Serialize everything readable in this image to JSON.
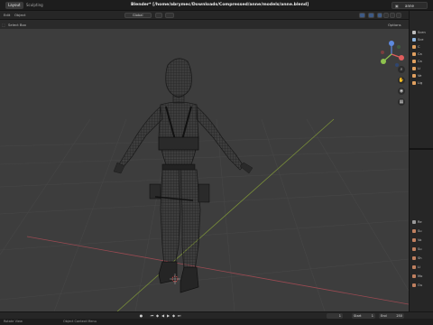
{
  "window": {
    "title": "Blender* [/home/abrymec/Downloads/Compressed/anne/models/anne.blend]"
  },
  "workspace_tabs": [
    {
      "label": "Layout",
      "active": true
    },
    {
      "label": "Sculpting",
      "active": false
    }
  ],
  "scene": {
    "name": "anne"
  },
  "header": {
    "menus": [
      "Edit",
      "Object"
    ],
    "transform_orientation": "Global",
    "select_mode": "Select Box",
    "options_label": "Options"
  },
  "outliner": {
    "items": [
      {
        "label": "Scen",
        "color": "#bdbdbd"
      },
      {
        "label": "Sce",
        "color": "#8fb6e0"
      },
      {
        "label": "C",
        "color": "#e0a060"
      },
      {
        "label": "Ca",
        "color": "#e0a060"
      },
      {
        "label": "Ca",
        "color": "#e0a060"
      },
      {
        "label": "Li",
        "color": "#e0a060"
      },
      {
        "label": "Ve",
        "color": "#e0a060"
      },
      {
        "label": "Lig",
        "color": "#e0a060"
      }
    ]
  },
  "properties": {
    "items": [
      {
        "label": "Re",
        "color": "#9a9a9a"
      },
      {
        "label": "Su",
        "color": "#c08060"
      },
      {
        "label": "Vo",
        "color": "#c08060"
      },
      {
        "label": "Su",
        "color": "#c08060"
      },
      {
        "label": "Sh",
        "color": "#c08060"
      },
      {
        "label": "Li",
        "color": "#c08060"
      },
      {
        "label": "Mo",
        "color": "#c08060"
      },
      {
        "label": "Ou",
        "color": "#c08060"
      }
    ]
  },
  "timeline": {
    "current_frame": "1",
    "start_label": "Start",
    "start_value": "1",
    "end_label": "End",
    "end_value": "250"
  },
  "status": {
    "left": "Rotate View",
    "middle": "Object Context Menu"
  },
  "colors": {
    "viewport_bg": "#3d3d3d",
    "grid": "#484848",
    "axis_x": "#9a4a52",
    "axis_y": "#7a8f3a",
    "wire": "#1a1a1a"
  },
  "icons": {
    "gizmo_x": "axis-x-icon",
    "gizmo_y": "axis-y-icon",
    "gizmo_z": "axis-z-icon",
    "zoom": "zoom-icon",
    "pan": "hand-icon",
    "camera": "camera-icon",
    "perspective": "grid-icon"
  }
}
